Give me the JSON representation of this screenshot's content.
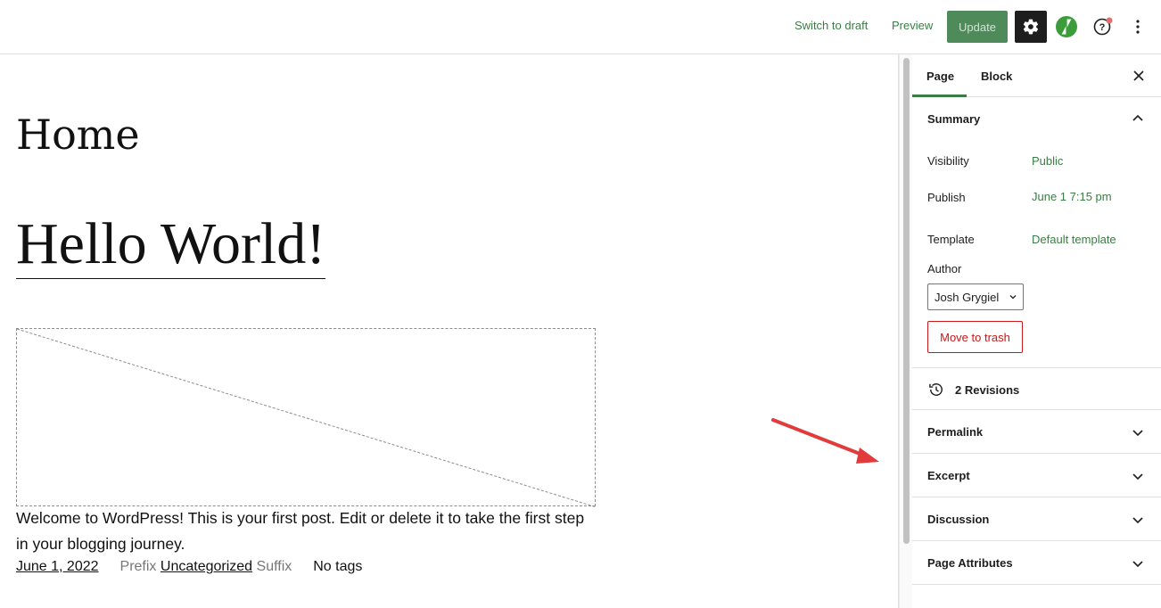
{
  "topbar": {
    "switch_to_draft": "Switch to draft",
    "preview": "Preview",
    "update": "Update",
    "accent": "#3a7d44"
  },
  "canvas": {
    "page_title": "Home",
    "post_title": "Hello World!",
    "excerpt": "Welcome to WordPress! This is your first post. Edit or delete it to take the first step in your blogging journey.",
    "meta": {
      "date": "June 1, 2022",
      "prefix": "Prefix",
      "category": "Uncategorized",
      "suffix": "Suffix",
      "tags": "No tags"
    }
  },
  "sidebar": {
    "tabs": [
      {
        "label": "Page",
        "active": true
      },
      {
        "label": "Block",
        "active": false
      }
    ],
    "summary": {
      "title": "Summary",
      "rows": [
        {
          "label": "Visibility",
          "value": "Public"
        },
        {
          "label": "Publish",
          "value": "June 1 7:15 pm"
        },
        {
          "label": "Template",
          "value": "Default template"
        }
      ],
      "author_label": "Author",
      "author_value": "Josh Grygiel",
      "trash_label": "Move to trash"
    },
    "revisions_label": "2 Revisions",
    "panels": [
      {
        "title": "Permalink"
      },
      {
        "title": "Excerpt"
      },
      {
        "title": "Discussion"
      },
      {
        "title": "Page Attributes"
      }
    ]
  },
  "icons": [
    "gear-icon",
    "jetpack-icon",
    "help-icon",
    "more-vertical-icon",
    "close-icon",
    "chevron-up-icon",
    "chevron-down-icon",
    "revisions-icon",
    "red-arrow"
  ]
}
